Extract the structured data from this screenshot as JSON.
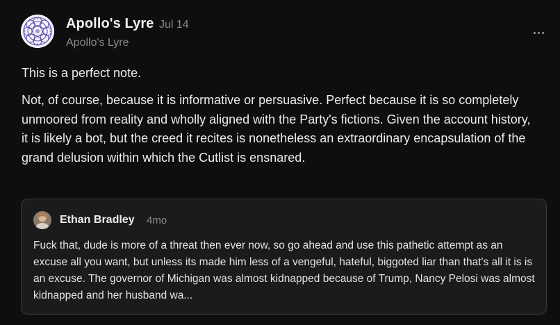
{
  "note": {
    "author": {
      "name": "Apollo's Lyre",
      "handle": "Apollo's Lyre",
      "date": "Jul 14",
      "avatar_icon": "mandala-avatar-icon"
    },
    "more_icon": "ellipsis-icon",
    "paragraphs": [
      "This is a perfect note.",
      "Not, of course, because it is informative or persuasive. Perfect because it is so completely unmoored from reality and wholly aligned with the Party's fictions. Given the account history, it is likely a bot, but the creed it recites is nonetheless an extraordinary encapsulation of the grand delusion within which the Cutlist is ensnared."
    ]
  },
  "quoted_note": {
    "author": "Ethan Bradley",
    "date": "4mo",
    "text": "Fuck that, dude is more of a threat then ever now, so go ahead and use this pathetic attempt as an excuse all you want, but unless its made him less of a vengeful, hateful, biggoted liar than that's all it is is an excuse. The governor of Michigan was almost kidnapped because of Trump, Nancy Pelosi was almost kidnapped and her husband wa..."
  },
  "colors": {
    "background": "#0e0e0e",
    "card_background": "#1b1b1b",
    "card_border": "#3a3a3a",
    "muted_text": "#8a8a8a",
    "avatar_accent": "#5a4fa8"
  }
}
